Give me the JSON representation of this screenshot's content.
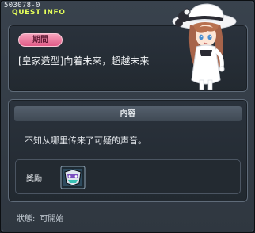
{
  "window": {
    "quest_id": "503078-0",
    "title": "QUEST INFO"
  },
  "top_panel": {
    "period_badge": "期間",
    "quest_name": "[皇家造型]向着未来，超越未来"
  },
  "content_panel": {
    "header": "內容",
    "description": "不知从哪里传来了可疑的声音。",
    "reward_label": "獎勵"
  },
  "status": {
    "label": "狀態:",
    "value": "可開始"
  },
  "colors": {
    "title_yellow": "#e6ff5a",
    "badge_pink": "#e05a86",
    "panel_bg": "#2a323c"
  },
  "icons": {
    "character": "character-illustration",
    "reward": "reward-item-icon"
  }
}
